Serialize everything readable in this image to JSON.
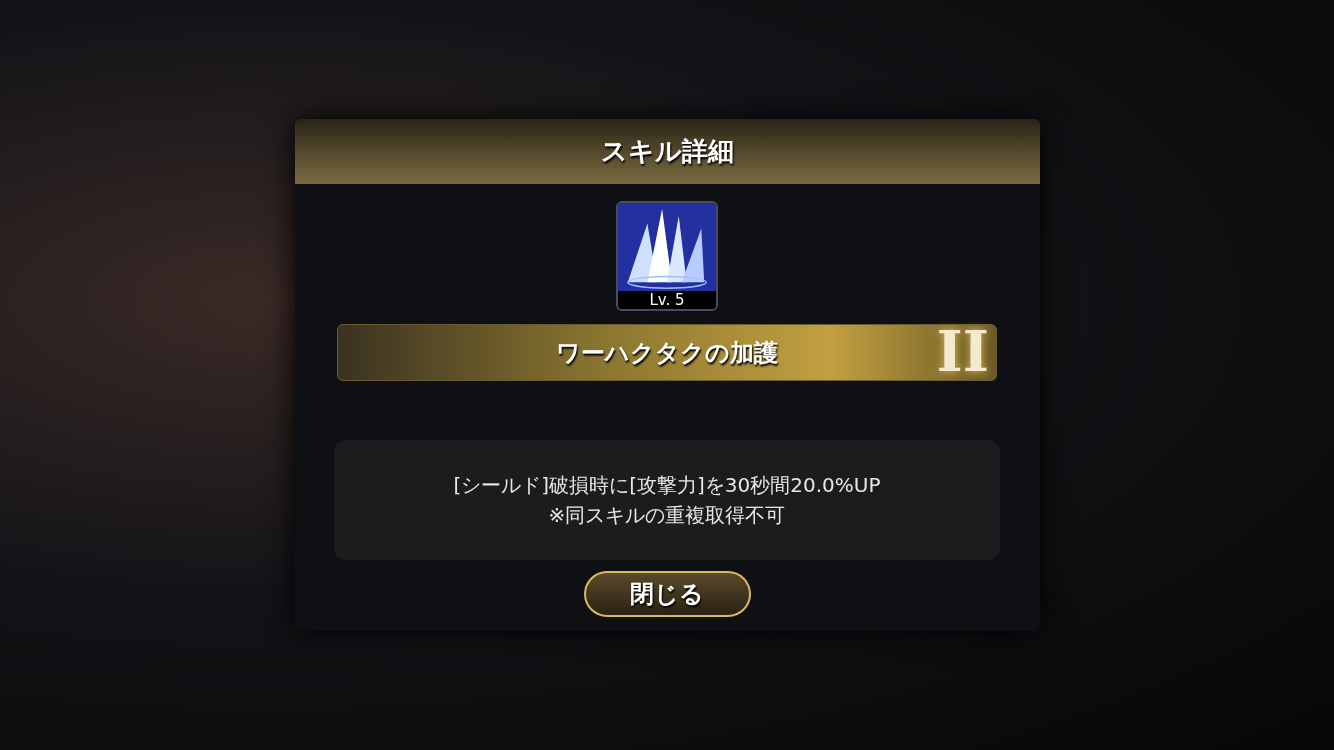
{
  "dialog": {
    "title": "スキル詳細",
    "skill": {
      "level": "Lv. 5",
      "name": "ワーハクタクの加護",
      "rank": "II"
    },
    "description": [
      "[シールド]破損時に[攻撃力]を30秒間20.0%UP",
      "※同スキルの重複取得不可"
    ],
    "buttons": [
      "閉じる"
    ]
  }
}
